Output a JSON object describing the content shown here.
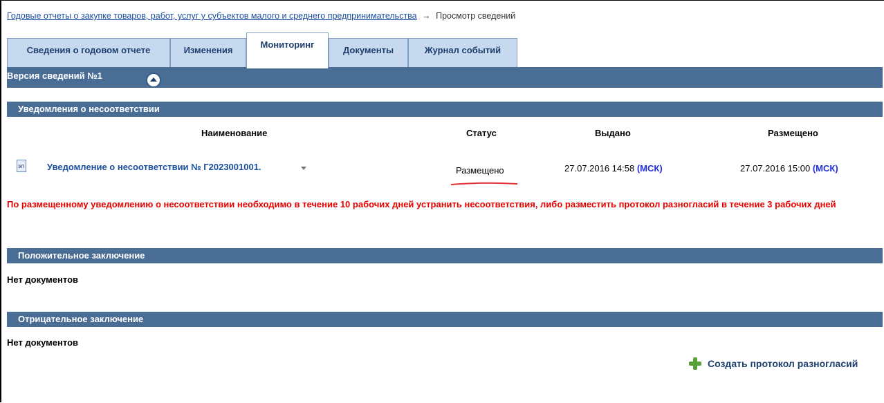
{
  "breadcrumb": {
    "link": "Годовые отчеты о закупке товаров, работ, услуг у субъектов малого и среднего предпринимательства",
    "arrow": "→",
    "current": "Просмотр сведений"
  },
  "tabs": [
    {
      "label": "Сведения о годовом отчете"
    },
    {
      "label": "Изменения"
    },
    {
      "label": "Мониторинг",
      "active": true
    },
    {
      "label": "Документы"
    },
    {
      "label": "Журнал событий"
    }
  ],
  "version": {
    "label": "Версия сведений №1"
  },
  "notices": {
    "section_title": "Уведомления о несоответствии",
    "columns": [
      "Наименование",
      "Статус",
      "Выдано",
      "Размещено"
    ],
    "row": {
      "name": "Уведомление о несоответствии № Г2023001001.",
      "status": "Размещено",
      "issued_date": "27.07.2016 14:58",
      "issued_tz": "(МСК)",
      "posted_date": "27.07.2016 15:00",
      "posted_tz": "(МСК)"
    },
    "warning": "По размещенному уведомлению о несоответствии необходимо в течение 10 рабочих дней устранить несоответствия, либо разместить протокол разногласий в течение 3 рабочих дней"
  },
  "positive": {
    "section_title": "Положительное заключение",
    "empty_text": "Нет документов"
  },
  "negative": {
    "section_title": "Отрицательное заключение",
    "empty_text": "Нет документов"
  },
  "actions": {
    "create_protocol": "Создать протокол разногласий"
  },
  "colors": {
    "header_bar": "#4a6d96",
    "tab_bg": "#c6d9ef",
    "link": "#1a4f9e",
    "warning": "#e60000",
    "timezone": "#1e2ee0",
    "plus": "#5aa03a"
  },
  "icons": {
    "doc": "signed-document-icon",
    "collapse": "collapse-up-icon",
    "dropdown": "chevron-down-icon",
    "create": "plus-icon"
  }
}
